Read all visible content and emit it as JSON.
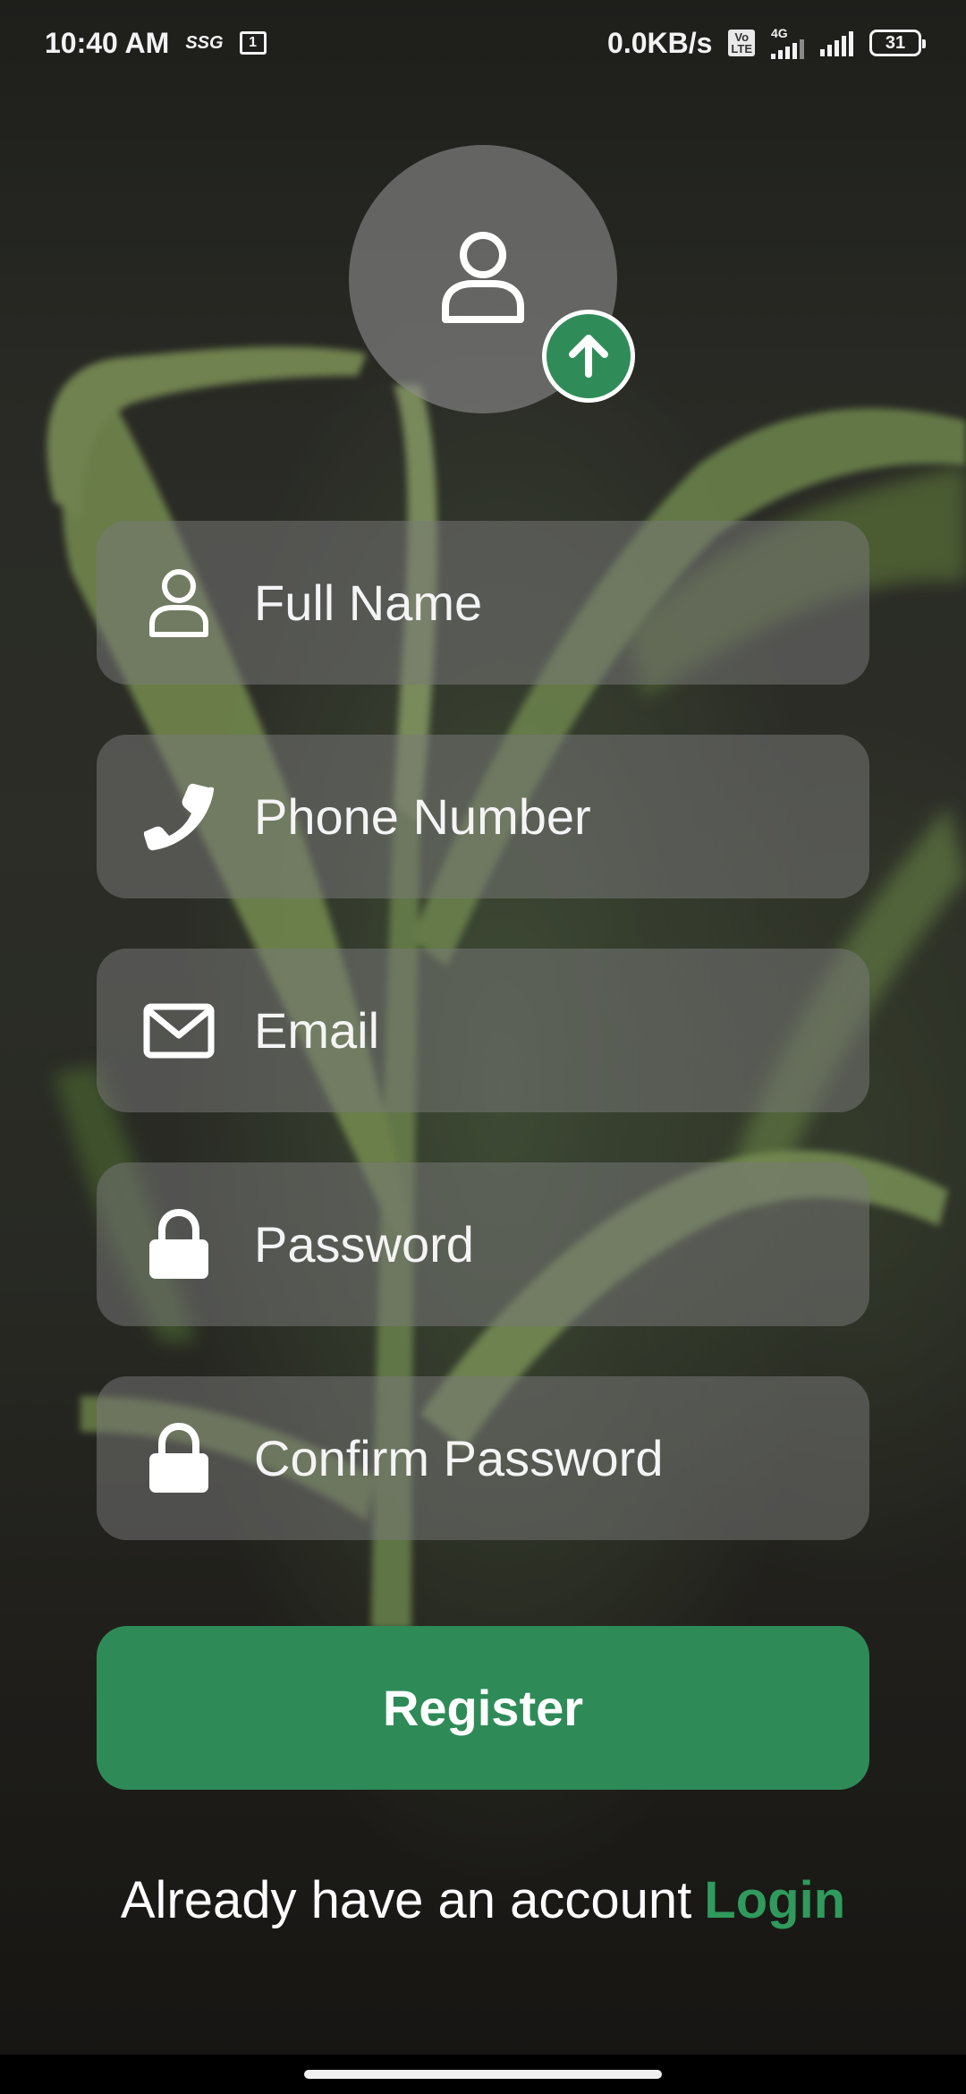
{
  "status_bar": {
    "time": "10:40 AM",
    "carrier_badge": "SSG",
    "notification_count": "1",
    "network_speed": "0.0KB/s",
    "volte_top": "Vo",
    "volte_bottom": "LTE",
    "network_type": "4G",
    "battery": "31"
  },
  "avatar": {
    "icon": "user-icon",
    "upload_icon": "arrow-up-icon"
  },
  "form": {
    "full_name": {
      "placeholder": "Full Name",
      "icon": "user-icon"
    },
    "phone": {
      "placeholder": "Phone Number",
      "icon": "phone-icon"
    },
    "email": {
      "placeholder": "Email",
      "icon": "envelope-icon"
    },
    "password": {
      "placeholder": "Password",
      "icon": "lock-icon"
    },
    "confirm_password": {
      "placeholder": "Confirm Password",
      "icon": "lock-icon"
    },
    "register_label": "Register"
  },
  "footer": {
    "prompt": "Already have an account",
    "login_label": "Login"
  },
  "colors": {
    "accent": "#2e8b57",
    "field_bg": "rgba(120,120,120,0.52)",
    "text": "#ffffff"
  }
}
